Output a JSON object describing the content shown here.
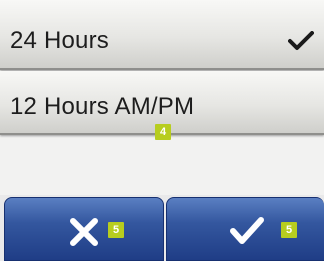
{
  "options": [
    {
      "label": "24 Hours",
      "selected": true
    },
    {
      "label": "12 Hours AM/PM",
      "selected": false
    }
  ],
  "badges": {
    "option_badge": "4",
    "cancel_badge": "5",
    "confirm_badge": "5",
    "color": "#b7cd1f"
  },
  "buttons": {
    "cancel_icon": "close-icon",
    "confirm_icon": "checkmark-icon",
    "accent": "#2a4a92"
  }
}
